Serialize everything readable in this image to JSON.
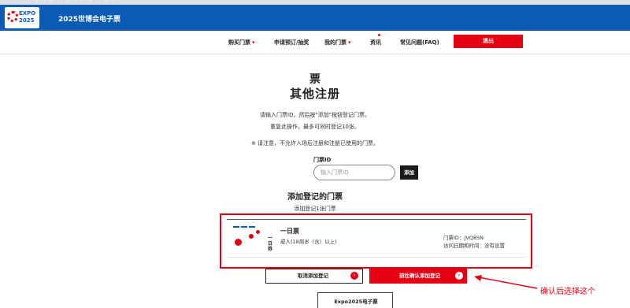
{
  "header": {
    "logo_text_line1": "EXPO",
    "logo_text_line2": "2025",
    "site_title": "2025世博会电子票"
  },
  "nav": {
    "items": [
      "购买门票",
      "申请预订/抽奖",
      "我的门票",
      "资讯",
      "常见问题(FAQ)"
    ],
    "logout": "退出"
  },
  "main": {
    "heading_ticket": "票",
    "heading_register": "其他注册",
    "desc1": "请输入门票ID，然后按\"添加\"按钮登记门票。",
    "desc2": "重复此操作，最多可同时登记10张。",
    "notice": "※ 请注意，不允许入场后注册和注册已使用的门票。",
    "ticket_id_label": "门票ID",
    "ticket_id_placeholder": "输入门票ID",
    "add_button": "添加",
    "added_heading": "添加登记的门票",
    "added_count": "添加登记1张门票"
  },
  "ticket": {
    "thumb_text": "一日券",
    "name": "一日票",
    "category": "成人(18周岁（含）以上)",
    "id_line": "门票ID：JVQ8SN",
    "visit_line": "访问日期和时间：没有设置"
  },
  "actions": {
    "cancel": "取消添加登记",
    "confirm": "前往确认添加登记"
  },
  "annotation": {
    "text": "确认后选择这个"
  },
  "footer": {
    "label": "Expo2025电子票"
  },
  "colors": {
    "brand_blue": "#0b5bb5",
    "accent_red": "#e60012"
  }
}
